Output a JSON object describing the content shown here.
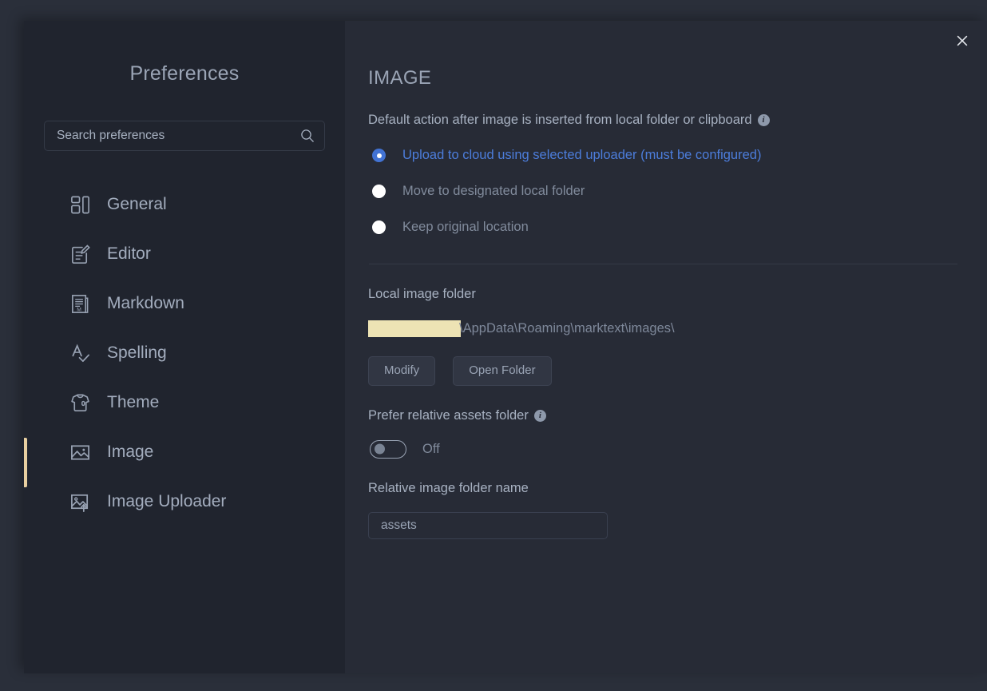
{
  "window": {
    "close_label": "×",
    "accent_active": "#e8cfa0",
    "accent_link": "#4c7ddb",
    "redaction_color": "#ede3b4",
    "sidebar_bg": "#20242e",
    "content_bg": "#272b36"
  },
  "sidebar": {
    "title": "Preferences",
    "search": {
      "placeholder": "Search preferences",
      "value": "",
      "icon": "search-icon"
    },
    "items": [
      {
        "label": "General",
        "icon": "layout-blocks-icon",
        "active": false
      },
      {
        "label": "Editor",
        "icon": "edit-document-icon",
        "active": false
      },
      {
        "label": "Markdown",
        "icon": "markdown-file-icon",
        "active": false
      },
      {
        "label": "Spelling",
        "icon": "spellcheck-icon",
        "active": false
      },
      {
        "label": "Theme",
        "icon": "tshirt-icon",
        "active": false
      },
      {
        "label": "Image",
        "icon": "image-icon",
        "active": true
      },
      {
        "label": "Image Uploader",
        "icon": "image-upload-icon",
        "active": false
      }
    ]
  },
  "main": {
    "title": "IMAGE",
    "default_action": {
      "label": "Default action after image is inserted from local folder or clipboard",
      "info_icon": "info-icon",
      "info_glyph": "i",
      "options": [
        {
          "label": "Upload to cloud using selected uploader (must be configured)",
          "selected": true
        },
        {
          "label": "Move to designated local folder",
          "selected": false
        },
        {
          "label": "Keep original location",
          "selected": false
        }
      ]
    },
    "local_image_folder": {
      "label": "Local image folder",
      "path_redacted": true,
      "path_visible": "\\AppData\\Roaming\\marktext\\images\\",
      "buttons": [
        {
          "label": "Modify"
        },
        {
          "label": "Open Folder"
        }
      ]
    },
    "prefer_relative": {
      "label": "Prefer relative assets folder",
      "info_glyph": "i",
      "state_label": "Off",
      "enabled": false
    },
    "relative_folder": {
      "label": "Relative image folder name",
      "value": "assets",
      "placeholder": "assets"
    }
  }
}
